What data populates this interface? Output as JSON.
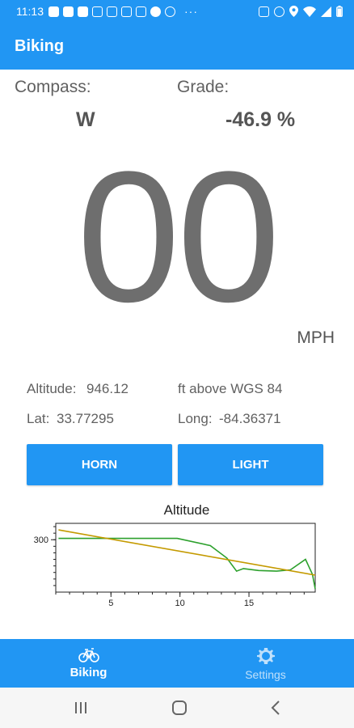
{
  "status_bar": {
    "time": "11:13"
  },
  "app": {
    "title": "Biking"
  },
  "compass": {
    "label": "Compass:",
    "value": "W"
  },
  "grade": {
    "label": "Grade:",
    "value": "-46.9 %"
  },
  "speed": {
    "value": "00",
    "unit": "MPH"
  },
  "altitude": {
    "label": "Altitude:",
    "value": "946.12",
    "unit": "ft above WGS 84"
  },
  "lat": {
    "label": "Lat:",
    "value": "33.77295"
  },
  "long": {
    "label": "Long:",
    "value": "-84.36371"
  },
  "buttons": {
    "horn": "HORN",
    "light": "LIGHT"
  },
  "chart_data": {
    "type": "line",
    "title": "Altitude",
    "xlabel": "",
    "ylabel": "",
    "xlim": [
      1,
      19.8
    ],
    "ylim": [
      220,
      325
    ],
    "xticks": [
      5,
      10,
      15
    ],
    "yticks": [
      300
    ],
    "series": [
      {
        "color": "#2ca02c",
        "x": [
          1.2,
          3,
          6,
          9.8,
          12.2,
          13.4,
          14.1,
          14.6,
          15.7,
          17,
          18,
          19.1,
          19.6,
          19.8
        ],
        "y": [
          302,
          302,
          302,
          302,
          291,
          272,
          252,
          256,
          253,
          252,
          254,
          270,
          247,
          225
        ]
      },
      {
        "color": "#c49a00",
        "x": [
          1.2,
          19.8
        ],
        "y": [
          315,
          246
        ]
      }
    ],
    "colors": {
      "line_observed": "#2ca02c",
      "trend": "#c49a00"
    }
  },
  "nav": {
    "biking": "Biking",
    "settings": "Settings"
  },
  "colors": {
    "primary": "#2196F3"
  }
}
